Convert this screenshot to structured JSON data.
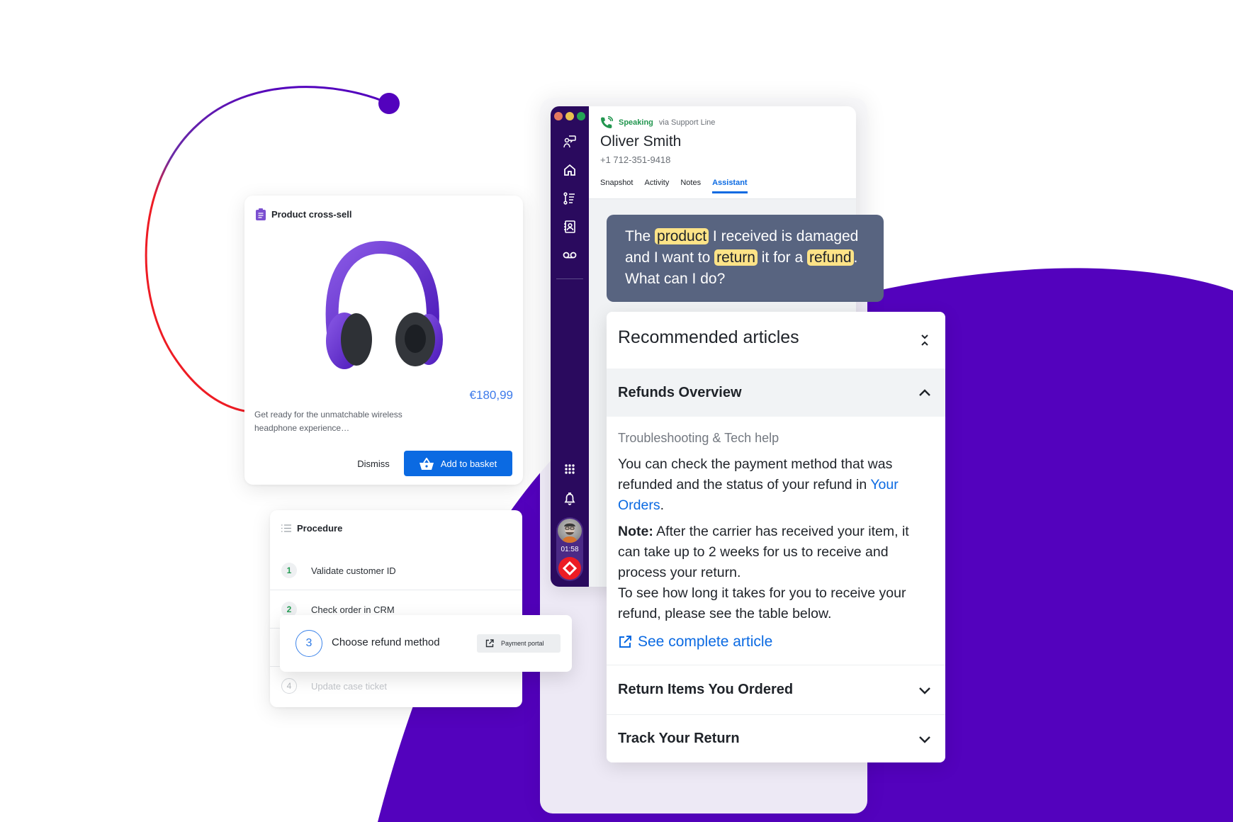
{
  "colors": {
    "brand_purple": "#5302bd",
    "sidebar": "#2a0a5e",
    "accent_blue": "#0b6ae2",
    "speaking_green": "#22964f",
    "hangup_red": "#ec1c24",
    "quote_bg": "#586480",
    "highlight": "#fde387"
  },
  "product_card": {
    "icon": "clipboard-icon",
    "title": "Product cross-sell",
    "image_alt": "Purple wireless headphones",
    "price": "€180,99",
    "description": "Get ready for the unmatchable wireless headphone experience…",
    "dismiss_label": "Dismiss",
    "add_label": "Add to basket"
  },
  "procedure": {
    "icon": "list-icon",
    "title": "Procedure",
    "steps": [
      {
        "num": "1",
        "label": "Validate customer ID"
      },
      {
        "num": "2",
        "label": "Check order in CRM"
      },
      {
        "num": "3",
        "label": "Choose refund method",
        "action": "Payment portal"
      },
      {
        "num": "4",
        "label": "Update case ticket"
      }
    ]
  },
  "phone": {
    "window_dots": [
      "#e5795f",
      "#e8c14f",
      "#23a455"
    ],
    "sidebar_icons": [
      "assistant-icon",
      "home-icon",
      "steps-icon",
      "contacts-icon",
      "voicemail-icon"
    ],
    "sidebar_bottom_icons": [
      "apps-grid-icon",
      "bell-icon"
    ],
    "call_timer": "01:58",
    "status": "Speaking",
    "via": "via Support Line",
    "caller_name": "Oliver Smith",
    "caller_number": "+1 712-351-9418",
    "tabs": [
      "Snapshot",
      "Activity",
      "Notes",
      "Assistant"
    ],
    "active_tab": "Assistant"
  },
  "transcript": {
    "parts": [
      {
        "text": "The ",
        "hl": false
      },
      {
        "text": "product",
        "hl": true
      },
      {
        "text": " I received is damaged and I want to ",
        "hl": false
      },
      {
        "text": "return",
        "hl": true
      },
      {
        "text": " it for a ",
        "hl": false
      },
      {
        "text": "refund",
        "hl": true
      },
      {
        "text": ". What can I do?",
        "hl": false
      }
    ]
  },
  "articles": {
    "title": "Recommended articles",
    "items": [
      {
        "title": "Refunds Overview",
        "expanded": true,
        "category": "Troubleshooting & Tech help",
        "p1_before": "You can check the payment method that was refunded and the status of your refund in ",
        "p1_link": "Your Orders",
        "p1_after": ".",
        "note_label": "Note:",
        "note_text": " After the carrier has received your item, it can take up to 2 weeks for us to receive and process your return.",
        "p3": "To see how long it takes for you to receive your refund, please see the table below.",
        "link_label": "See complete article"
      },
      {
        "title": "Return Items You Ordered",
        "expanded": false
      },
      {
        "title": "Track Your Return",
        "expanded": false
      }
    ]
  }
}
